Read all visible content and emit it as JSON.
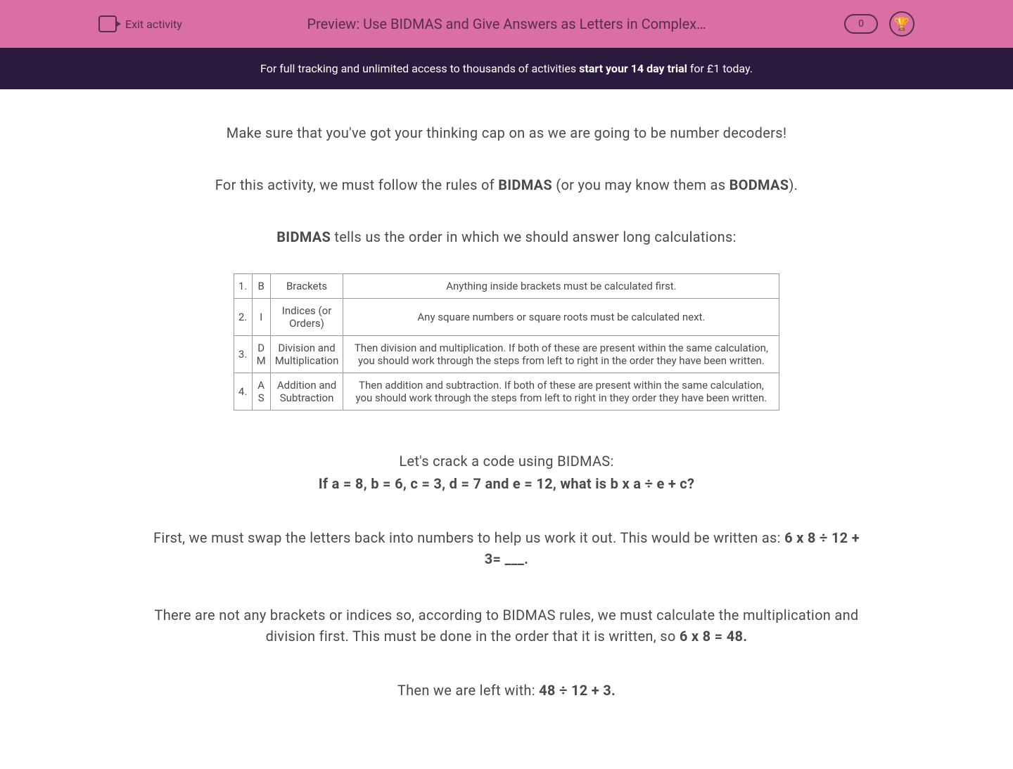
{
  "header": {
    "exit_label": "Exit activity",
    "title": "Preview: Use BIDMAS and Give Answers as Letters in Complex…",
    "score": "0"
  },
  "promo": {
    "prefix": "For full tracking and unlimited access to thousands of activities ",
    "bold": "start your 14 day trial",
    "suffix": " for £1 today."
  },
  "content": {
    "intro": "Make sure that you've got your thinking cap on as we are going to be number decoders!",
    "rules_prefix": "For this activity, we must follow the rules of ",
    "rules_bidmas": "BIDMAS",
    "rules_mid": " (or you may know them as ",
    "rules_bodmas": "BODMAS",
    "rules_suffix": ").",
    "order_prefix": "BIDMAS",
    "order_suffix": " tells us the order in which we should answer long calculations:",
    "code_intro": "Let's crack a code using BIDMAS:",
    "code_question": "If a = 8, b = 6, c = 3, d = 7 and e = 12, what is b x a ÷ e + c?",
    "explain1_prefix": "First, we must swap the letters back into numbers to help us work it out. This would be written as: ",
    "explain1_bold": "6 x 8 ÷ 12 + 3= ___.",
    "explain2_prefix": "There are not any brackets or indices so, according to BIDMAS rules, we must calculate the multiplication and division first. This must be done in the order that it is written, so ",
    "explain2_bold": "6 x 8 = 48.",
    "step_prefix": "Then we are left with: ",
    "step_bold": "48 ÷ 12 + 3."
  },
  "table": {
    "rows": [
      {
        "num": "1.",
        "letter": "B",
        "name": "Brackets",
        "desc": "Anything inside brackets must be calculated first."
      },
      {
        "num": "2.",
        "letter": "I",
        "name": "Indices (or Orders)",
        "desc": "Any square numbers or square roots must be calculated next."
      },
      {
        "num": "3.",
        "letter": "D M",
        "name": "Division and Multiplication",
        "desc": "Then division and multiplication. If both of these are present within the same calculation, you should work through the steps from left to right in the order they have been written."
      },
      {
        "num": "4.",
        "letter": "A S",
        "name": "Addition and Subtraction",
        "desc": "Then addition and subtraction. If both of these are present within the same calculation, you should work through the steps from left to right in they order they have been written."
      }
    ]
  }
}
